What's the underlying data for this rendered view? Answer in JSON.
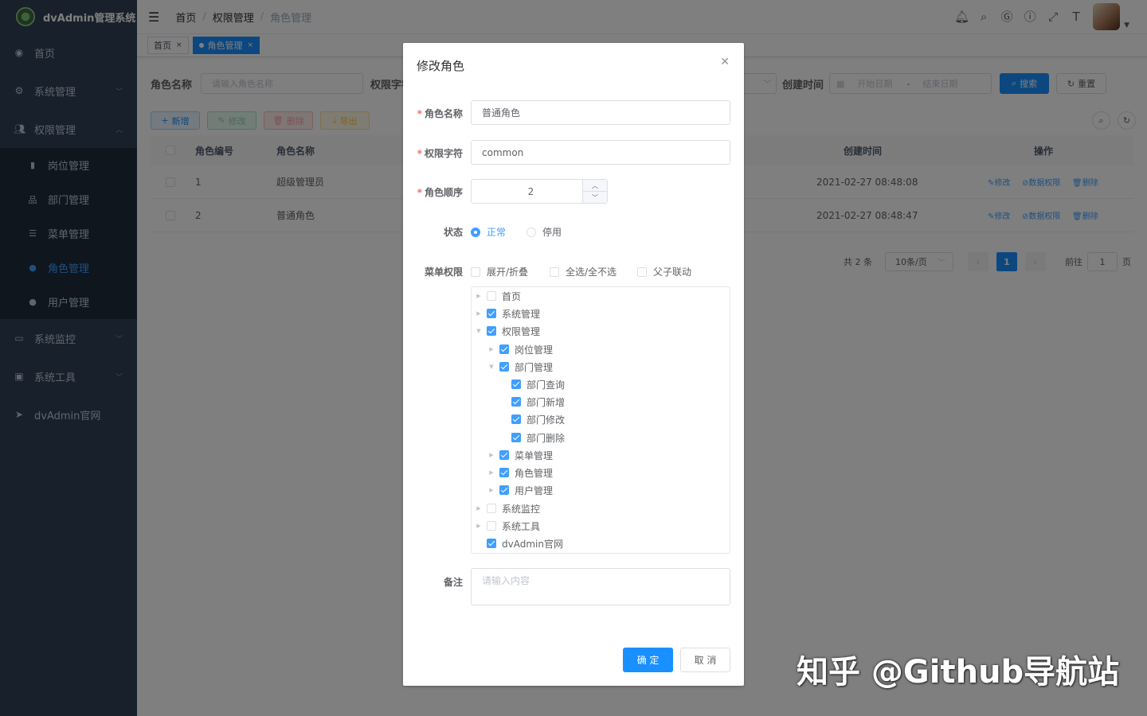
{
  "app": {
    "title": "dvAdmin管理系统"
  },
  "sidebar": {
    "items": [
      {
        "label": "首页",
        "icon": "dashboard-icon"
      },
      {
        "label": "系统管理",
        "icon": "gear-icon"
      },
      {
        "label": "权限管理",
        "icon": "users-icon"
      },
      {
        "label": "系统监控",
        "icon": "monitor-icon"
      },
      {
        "label": "系统工具",
        "icon": "toolbox-icon"
      },
      {
        "label": "dvAdmin官网",
        "icon": "send-icon"
      }
    ],
    "sub_items": [
      {
        "label": "岗位管理"
      },
      {
        "label": "部门管理"
      },
      {
        "label": "菜单管理"
      },
      {
        "label": "角色管理"
      },
      {
        "label": "用户管理"
      }
    ]
  },
  "breadcrumb": {
    "home": "首页",
    "parent": "权限管理",
    "current": "角色管理"
  },
  "tags": {
    "home": "首页",
    "current": "角色管理"
  },
  "search": {
    "role_name_label": "角色名称",
    "role_name_placeholder": "请输入角色名称",
    "perm_label": "权限字符",
    "created_label": "创建时间",
    "start_placeholder": "开始日期",
    "range_sep": "-",
    "end_placeholder": "结束日期",
    "search_button": "搜索",
    "reset_button": "重置"
  },
  "toolbar": {
    "add": "新增",
    "edit": "修改",
    "delete": "删除",
    "export": "导出"
  },
  "table": {
    "headers": {
      "id": "角色编号",
      "name": "角色名称",
      "created": "创建时间",
      "ops": "操作"
    },
    "rows": [
      {
        "id": "1",
        "name": "超级管理员",
        "created": "2021-02-27 08:48:08"
      },
      {
        "id": "2",
        "name": "普通角色",
        "created": "2021-02-27 08:48:47"
      }
    ],
    "op_edit": "修改",
    "op_data": "数据权限",
    "op_delete": "删除"
  },
  "pager": {
    "total": "共 2 条",
    "page_size": "10条/页",
    "current": "1",
    "goto_prefix": "前往",
    "goto_value": "1",
    "goto_suffix": "页"
  },
  "dialog": {
    "title": "修改角色",
    "role_name_label": "角色名称",
    "role_name_value": "普通角色",
    "perm_label": "权限字符",
    "perm_value": "common",
    "order_label": "角色顺序",
    "order_value": "2",
    "status_label": "状态",
    "status_options": [
      "正常",
      "停用"
    ],
    "status_selected": "正常",
    "menu_label": "菜单权限",
    "menu_opts": [
      "展开/折叠",
      "全选/全不选",
      "父子联动"
    ],
    "tree": [
      {
        "label": "首页",
        "checked": false
      },
      {
        "label": "系统管理",
        "checked": true
      },
      {
        "label": "权限管理",
        "checked": true
      },
      {
        "label": "岗位管理",
        "checked": true
      },
      {
        "label": "部门管理",
        "checked": true
      },
      {
        "label": "部门查询",
        "checked": true
      },
      {
        "label": "部门新增",
        "checked": true
      },
      {
        "label": "部门修改",
        "checked": true
      },
      {
        "label": "部门删除",
        "checked": true
      },
      {
        "label": "菜单管理",
        "checked": true
      },
      {
        "label": "角色管理",
        "checked": true
      },
      {
        "label": "用户管理",
        "checked": true
      },
      {
        "label": "系统监控",
        "checked": false
      },
      {
        "label": "系统工具",
        "checked": false
      },
      {
        "label": "dvAdmin官网",
        "checked": true
      }
    ],
    "remark_label": "备注",
    "remark_placeholder": "请输入内容",
    "confirm": "确 定",
    "cancel": "取 消"
  },
  "watermark": "知乎 @Github导航站",
  "colors": {
    "primary": "#409eff",
    "sidebar_bg": "#304156",
    "submenu_bg": "#1f2d3d",
    "danger": "#f56c6c"
  }
}
